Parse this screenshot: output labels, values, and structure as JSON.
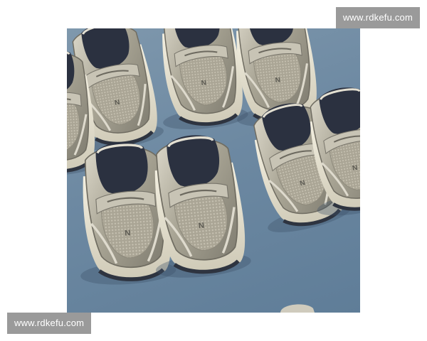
{
  "watermark_top": "www.rdkefu.com",
  "watermark_bottom": "www.rdkefu.com",
  "photo": {
    "subject": "shoe",
    "colors": {
      "background": "#6f8aa3",
      "metal": "#b8b4a6",
      "mesh": "#a9a393",
      "sole": "#ece8d8",
      "lining": "#2b3140"
    }
  }
}
